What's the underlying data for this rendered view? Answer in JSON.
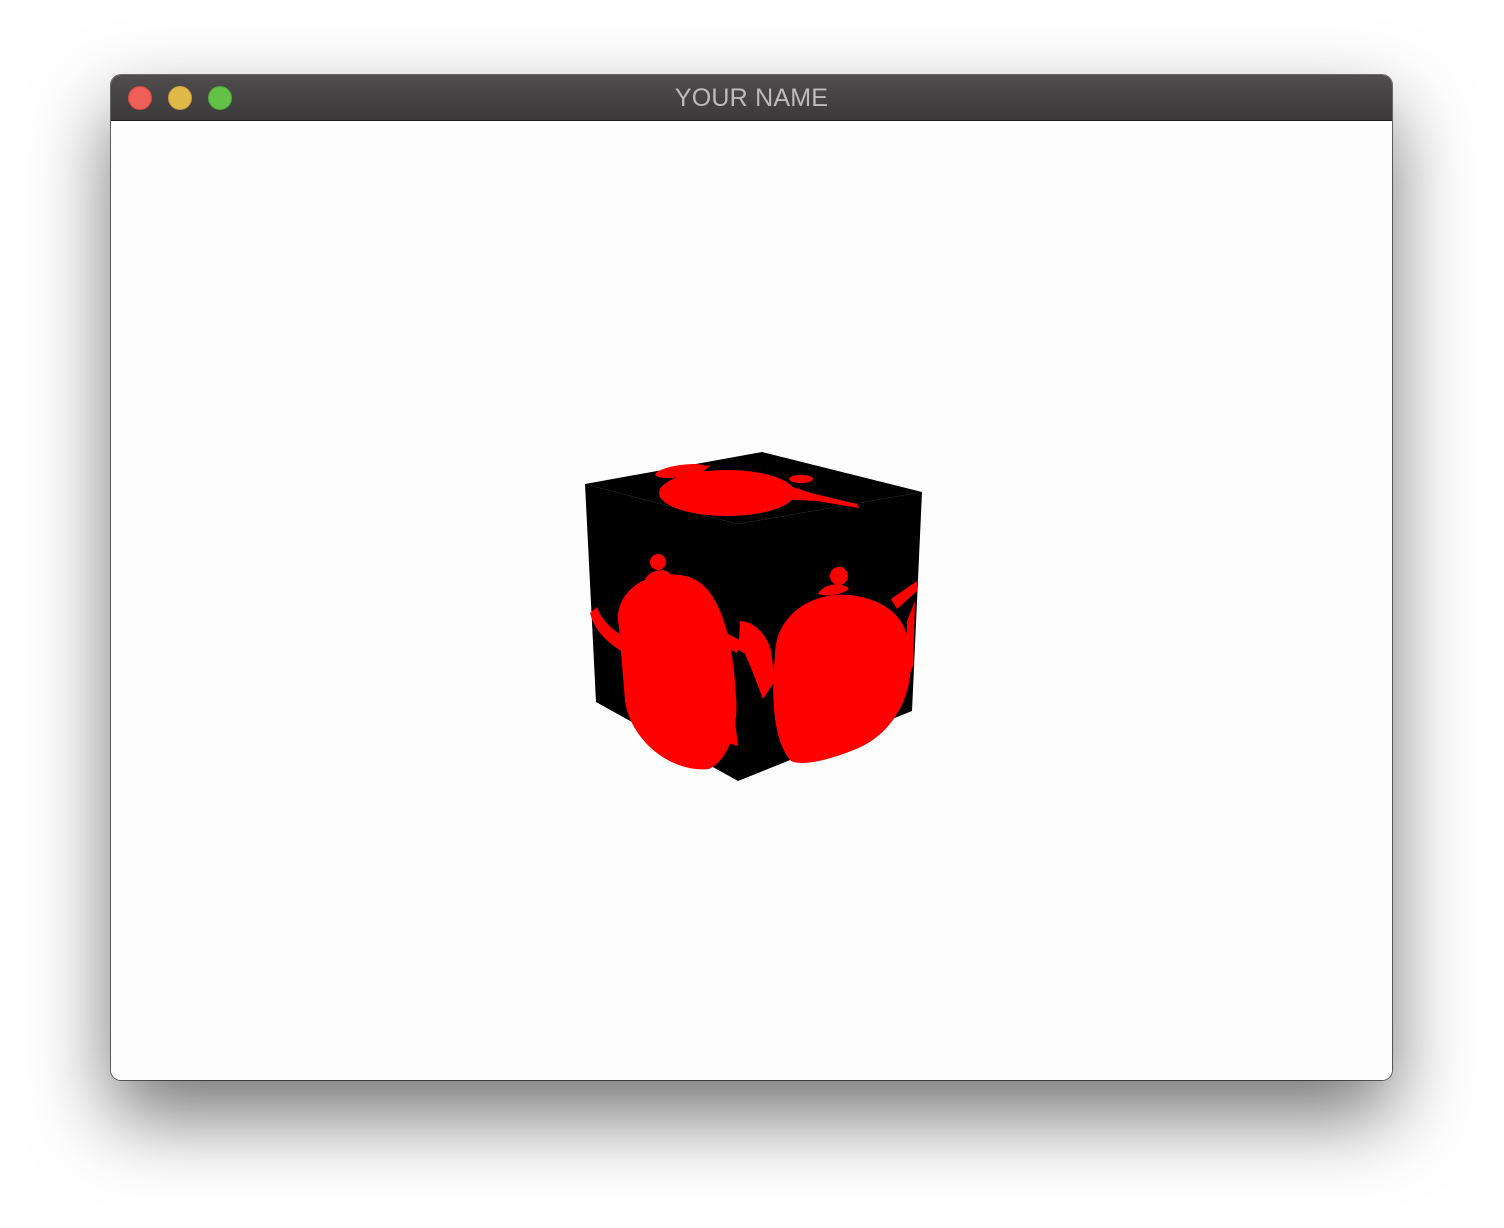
{
  "window": {
    "title": "YOUR NAME",
    "background_color": "#fdfdfd",
    "titlebar_color": "#454344"
  },
  "traffic_lights": {
    "close_color": "#ee5f57",
    "minimize_color": "#e1b949",
    "zoom_color": "#63c148"
  },
  "scene": {
    "object": "cube",
    "face_color": "#000000",
    "texture_color": "#ff0000",
    "texture_motif": "teapot-silhouette"
  }
}
